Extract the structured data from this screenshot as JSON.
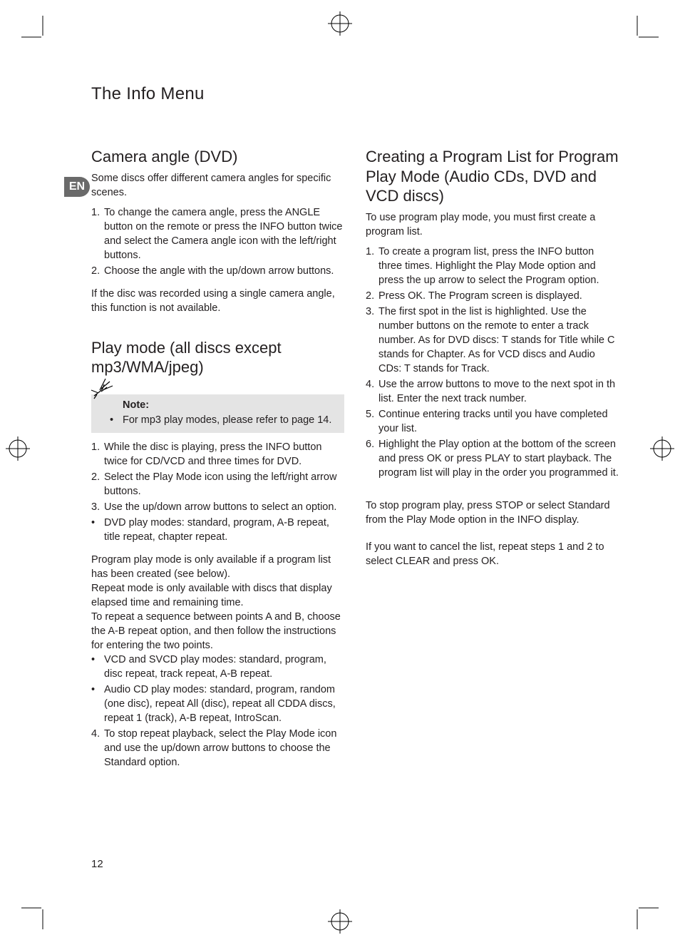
{
  "page_title": "The Info Menu",
  "lang_badge": "EN",
  "page_number": "12",
  "left": {
    "sec1": {
      "heading": "Camera angle (DVD)",
      "intro": "Some discs offer different camera angles for specific scenes.",
      "steps": [
        {
          "n": "1.",
          "t": "To change the camera angle, press the ANGLE button on the remote or press the INFO button twice and select the Camera angle icon with the left/right buttons."
        },
        {
          "n": "2.",
          "t": "Choose the angle with the up/down arrow buttons."
        }
      ],
      "outro": "If the disc was recorded using a single camera angle, this function is not available."
    },
    "sec2": {
      "heading": "Play mode (all discs except mp3/WMA/jpeg)",
      "note_label": "Note:",
      "note_bullet": "For mp3 play modes, please refer to page 14.",
      "steps1": [
        {
          "n": "1.",
          "t": "While the disc is playing, press the INFO button twice for CD/VCD and three times for DVD."
        },
        {
          "n": "2.",
          "t": "Select the Play Mode icon using the left/right arrow buttons."
        },
        {
          "n": "3.",
          "t": "Use the up/down arrow buttons to select an option."
        }
      ],
      "bullets1": [
        "DVD play modes: standard, program, A-B repeat, title repeat, chapter repeat."
      ],
      "para1": "Program play mode is only available if a program list has been created (see below).",
      "para2": "Repeat mode is only available with discs that display elapsed time and remaining time.",
      "para3": "To repeat a sequence between points A and B, choose the A-B repeat option, and then follow the instructions for entering the two points.",
      "bullets2": [
        "VCD and SVCD play modes: standard, program, disc repeat, track repeat, A-B repeat.",
        "Audio CD play modes: standard, program, random (one disc), repeat All (disc), repeat all CDDA discs, repeat 1 (track), A-B repeat, IntroScan."
      ],
      "steps2": [
        {
          "n": "4.",
          "t": "To stop repeat playback, select the Play Mode icon and use the up/down arrow buttons to choose the Standard option."
        }
      ]
    }
  },
  "right": {
    "sec1": {
      "heading": "Creating a Program List for Program Play Mode (Audio CDs, DVD and VCD discs)",
      "intro": "To use program play mode, you must first create a program list.",
      "steps": [
        {
          "n": "1.",
          "t": "To create a program list, press the INFO button three times. Highlight the Play Mode option and press the up arrow to select the Program option."
        },
        {
          "n": "2.",
          "t": "Press OK. The Program screen is displayed."
        },
        {
          "n": "3.",
          "t": "The first spot in the list is highlighted. Use the number buttons on the remote to enter a track number. As for DVD discs: T stands for Title while C stands for Chapter. As for VCD discs and Audio CDs: T stands for Track."
        },
        {
          "n": "4.",
          "t": "Use the arrow buttons to move to the next spot in th list. Enter the next track number."
        },
        {
          "n": "5.",
          "t": "Continue entering tracks until you have completed your list."
        },
        {
          "n": "6.",
          "t": "Highlight the Play option at the bottom of the screen and press OK or press PLAY to start playback. The program list will play in the order you programmed it."
        }
      ],
      "para1": "To stop program play, press STOP or select Standard from the Play Mode option in the INFO display.",
      "para2": "If you want to cancel the list, repeat steps 1 and 2 to select CLEAR and press OK."
    }
  }
}
